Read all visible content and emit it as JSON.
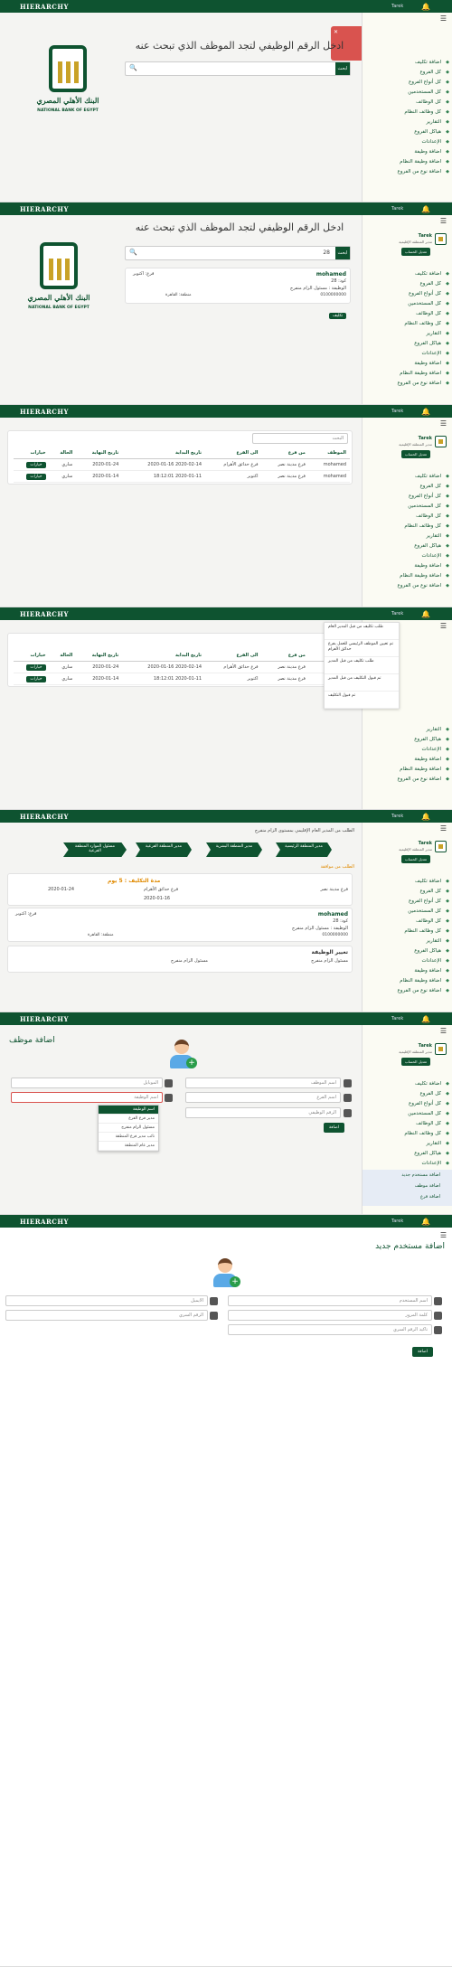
{
  "brand": "HIERARCHY",
  "user": "Tarek",
  "profile": {
    "name": "Tarek",
    "role": "مدير المنطقة الإقليمية",
    "button": "تعديل الحساب"
  },
  "menu": [
    "اضافة تكليف",
    "كل الفروع",
    "كل أنواع الفروع",
    "كل المستخدمين",
    "كل الوظائف",
    "كل وظائف النظام",
    "التقارير",
    "هياكل الفروع",
    "الإعدادات",
    "اضافة وظيفة",
    "اضافة وظيفة النظام",
    "اضافة نوع من الفروع"
  ],
  "submenu": [
    "اضافة مستخدم جديد",
    "اضافة موظف",
    "اضافة فرع"
  ],
  "logo": {
    "ar": "البنك الأهلي المصري",
    "en": "NATIONAL BANK OF EGYPT"
  },
  "search": {
    "heading": "ادخل الرقم الوظيفي لتجد الموظف الذي تبحث عنه",
    "btn": "ابحث",
    "value": "28"
  },
  "toast": {
    "title": "! خطأ",
    "body": "لا يوجد موظف بكود \"H\""
  },
  "emp": {
    "name": "mohamed",
    "code": "كود: 28",
    "branch": "فرع: اكتوبر",
    "job": "الوظيفة : مسئول الزام منفرج",
    "phone": "0100000000",
    "region": "منطقة: القاهرة",
    "btn": "تكليف"
  },
  "table": {
    "search": "البحث",
    "headers": [
      "الموظف",
      "من فرع",
      "الى الفرع",
      "تاريخ البداية",
      "تاريخ النهاية",
      "الحالة",
      "خيارات"
    ],
    "rows": [
      [
        "mohamed",
        "فرع مدينة نصر",
        "فرع حدائق الأهرام",
        "2020-02-14 2020-01-16",
        "2020-01-24",
        "ساري",
        "خيارات"
      ],
      [
        "mohamed",
        "فرع مدينة نصر",
        "اكتوبر",
        "2020-01-11 18:12:01",
        "2020-01-14",
        "ساري",
        "خيارات"
      ]
    ]
  },
  "notifs": [
    "طلب تكليف من قبل المدير العام",
    "تم تعيين الموظف الرئيسي للعمل بفرع حدائق الأهرام",
    "طلب تكليف من قبل المدير",
    "تم قبول التكليف من قبل المدير",
    "تم قبول التكليف"
  ],
  "detail": {
    "breadcrumb": "الطلب من المدير العام الإقليمي بمستوى الزام منفرج",
    "steps": [
      "مدير المنطقة الرئيسية",
      "مدير المنطقة البشرية",
      "مدير المنطقة الفرعية",
      "مسئول الموارد المنطقة الفرعية"
    ],
    "status": "الطلب من موافقة",
    "period": "مدة التكليف : 5 يوم",
    "from": "فرع مدينة نصر",
    "to": "فرع حدائق الأهرام",
    "start": "2020-01-16",
    "end": "2020-01-24",
    "jobchange": "تغيير الوظيفة",
    "old": "مسئول الزام منفرج",
    "new": "مسئول الزام منفرج"
  },
  "add_emp": {
    "title": "اضافة موظف",
    "f1": "اسم الموظف",
    "f2": "اسم الفرع",
    "f3": "الرقم الوظيفي",
    "f4": "الموبايل",
    "f5": "اسم الوظيفة",
    "save": "اضافة",
    "dropdown": [
      "اسم الوظيفة",
      "مدير فرع الفرع",
      "مسئول الزام منفرج",
      "نائب مدير فرع المنطقة",
      "مدير عام المنطقة"
    ]
  },
  "add_user": {
    "title": "اضافة مستخدم جديد",
    "f1": "اسم المستخدم",
    "f2": "الايميل",
    "f3": "كلمة المرور",
    "f4": "الرقم السري",
    "f5": "تاكيد الرقم السري",
    "save": "اضافة"
  }
}
